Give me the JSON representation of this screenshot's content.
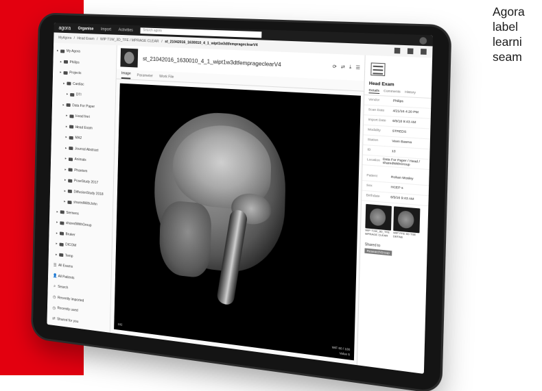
{
  "promo_text": {
    "lines": [
      "Agora",
      "label",
      "learni",
      "seam"
    ]
  },
  "nav": {
    "logo": "agora",
    "items": [
      {
        "label": "Organise",
        "active": true
      },
      {
        "label": "Import",
        "active": false
      },
      {
        "label": "Activities",
        "active": false
      }
    ],
    "search_placeholder": "Search agora"
  },
  "breadcrumb": [
    "MyAgora",
    "Head Exam",
    "WIP T1W_3D_TFE / MPRAGE CLEAR",
    "st_21042016_1630010_4_1_wipt1w3dtfemprageclearV4"
  ],
  "sidebar": {
    "tree": [
      {
        "label": "My Agora",
        "icon": "folder"
      },
      {
        "label": "Philips",
        "icon": "folder"
      },
      {
        "label": "Projects",
        "icon": "folder"
      },
      {
        "label": "Cardiac",
        "icon": "folder"
      },
      {
        "label": "DTI",
        "icon": "folder"
      },
      {
        "label": "Data For Paper",
        "icon": "folder"
      },
      {
        "label": "Head fmri",
        "icon": "folder"
      },
      {
        "label": "Head Exam",
        "icon": "folder"
      },
      {
        "label": "MA2",
        "icon": "folder"
      },
      {
        "label": "Journal Abstract",
        "icon": "folder"
      },
      {
        "label": "Animals",
        "icon": "folder"
      },
      {
        "label": "Phantom",
        "icon": "folder"
      },
      {
        "label": "PoseStudy 2017",
        "icon": "folder"
      },
      {
        "label": "DiffusionStudy 2018",
        "icon": "folder"
      },
      {
        "label": "sharedWithJohn",
        "icon": "folder"
      },
      {
        "label": "Siemens",
        "icon": "folder"
      },
      {
        "label": "sharedWithGroup",
        "icon": "folder"
      },
      {
        "label": "Bruker",
        "icon": "folder"
      },
      {
        "label": "DICOM",
        "icon": "folder"
      },
      {
        "label": "Temp",
        "icon": "folder"
      },
      {
        "label": "All Exams",
        "icon": "list"
      },
      {
        "label": "All Patients",
        "icon": "person"
      },
      {
        "label": "Search",
        "icon": "search"
      },
      {
        "label": "Recently imported",
        "icon": "clock"
      },
      {
        "label": "Recently used",
        "icon": "clock"
      },
      {
        "label": "Shared for you",
        "icon": "share"
      }
    ]
  },
  "viewer": {
    "title": "st_21042016_1630010_4_1_wipt1w3dtfemprageclearV4",
    "tabs": [
      "Image",
      "Parameter",
      "Work File"
    ],
    "overlay_bottom_left": "192",
    "overlay_bottom_right_1": "W/F 60 / 100",
    "overlay_bottom_right_2": "Value 5"
  },
  "panel": {
    "title": "Head Exam",
    "tabs": [
      "Details",
      "Comments",
      "History"
    ],
    "details": [
      {
        "k": "Vendor",
        "v": "Philips"
      },
      {
        "k": "Scan Date",
        "v": "4/21/16 4:20 PM"
      },
      {
        "k": "Import Date",
        "v": "6/5/18 9:43 AM"
      },
      {
        "k": "Modality",
        "v": "STREDS"
      },
      {
        "k": "Station",
        "v": "Veen Basma"
      },
      {
        "k": "ID",
        "v": "13"
      },
      {
        "k": "Location",
        "v": "Data For Paper / Head / sharedWithGroup"
      }
    ],
    "extra": [
      {
        "k": "Patient",
        "v": "Rohan Mosley"
      },
      {
        "k": "Sex",
        "v": "HCEP s"
      },
      {
        "k": "Birthdate",
        "v": "6/5/16 9:43 AM"
      }
    ],
    "series": [
      {
        "caption": "WIP T1W_3D_TFE MPRAGE CLEAR"
      },
      {
        "caption": "WIP FFE 4D TSE DEFAB"
      }
    ],
    "shared_label": "Shared to",
    "shared_tag": "ResearchGroup"
  },
  "colors": {
    "accent_red": "#e3000f",
    "nav_bg": "#1d1d1d"
  }
}
